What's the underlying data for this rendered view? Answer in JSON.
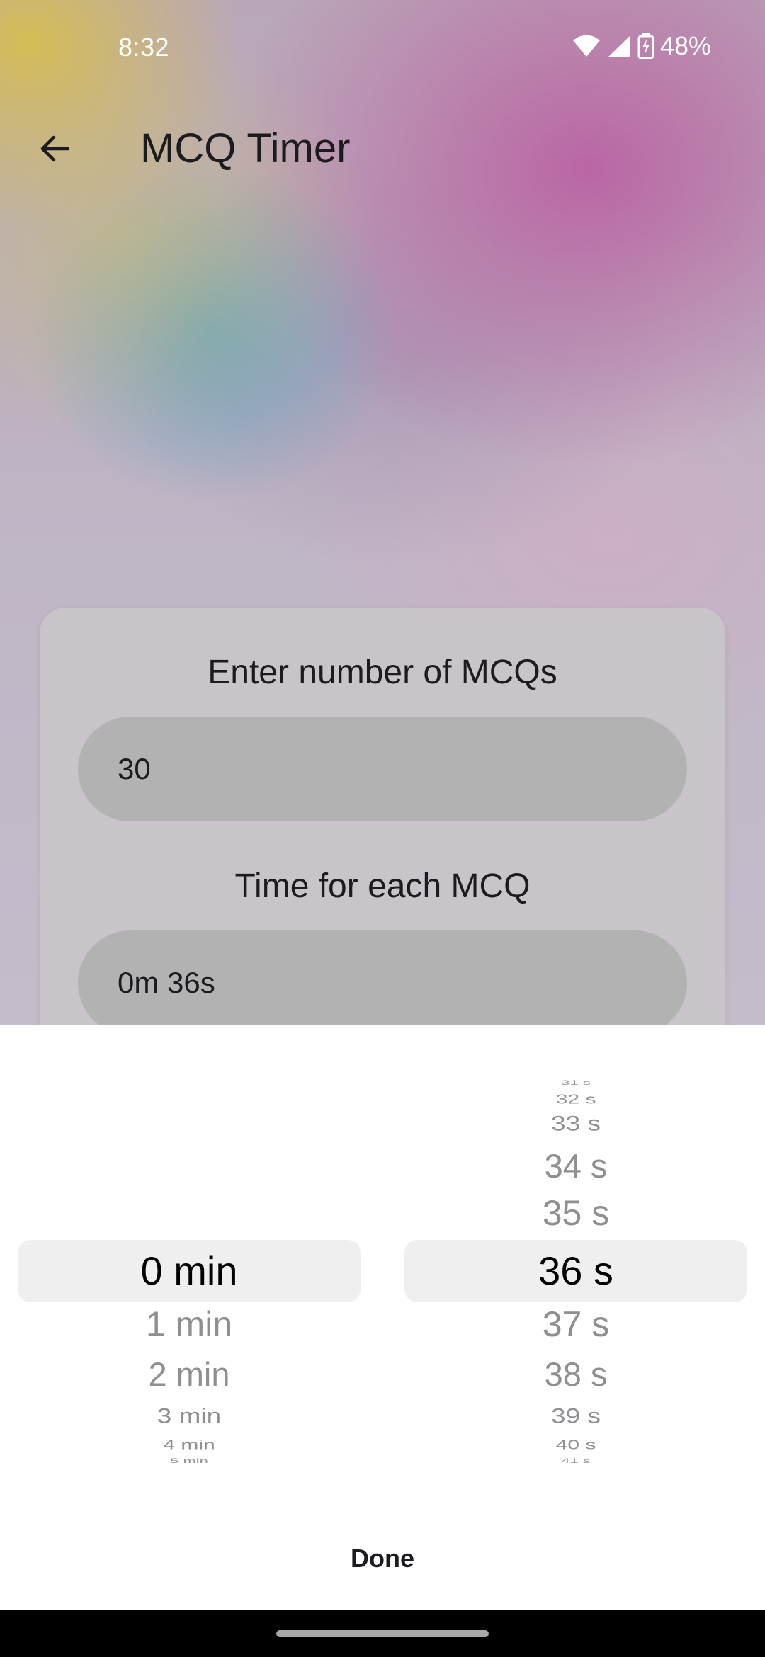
{
  "status_bar": {
    "time": "8:32",
    "battery_percent": "48%",
    "icons": [
      "wifi-icon",
      "signal-icon",
      "battery-charging-icon"
    ]
  },
  "app_bar": {
    "title": "MCQ Timer",
    "back_icon": "arrow-back-icon"
  },
  "form": {
    "mcq_count_label": "Enter number of MCQs",
    "mcq_count_value": "30",
    "time_label": "Time for each MCQ",
    "time_value": "0m 36s"
  },
  "picker": {
    "minutes": {
      "selected": "0 min",
      "items": [
        "0 min",
        "1 min",
        "2 min",
        "3 min",
        "4 min",
        "5 min"
      ]
    },
    "seconds": {
      "selected": "36 s",
      "items": [
        "31 s",
        "32 s",
        "33 s",
        "34 s",
        "35 s",
        "36 s",
        "37 s",
        "38 s",
        "39 s",
        "40 s",
        "41 s"
      ]
    },
    "done_label": "Done"
  },
  "colors": {
    "sheet_background": "#ffffff",
    "selection_highlight": "#efefef",
    "pill_background": "#b2b2b2",
    "card_background": "#c9c3ca",
    "unselected_text": "#8e8e93"
  }
}
